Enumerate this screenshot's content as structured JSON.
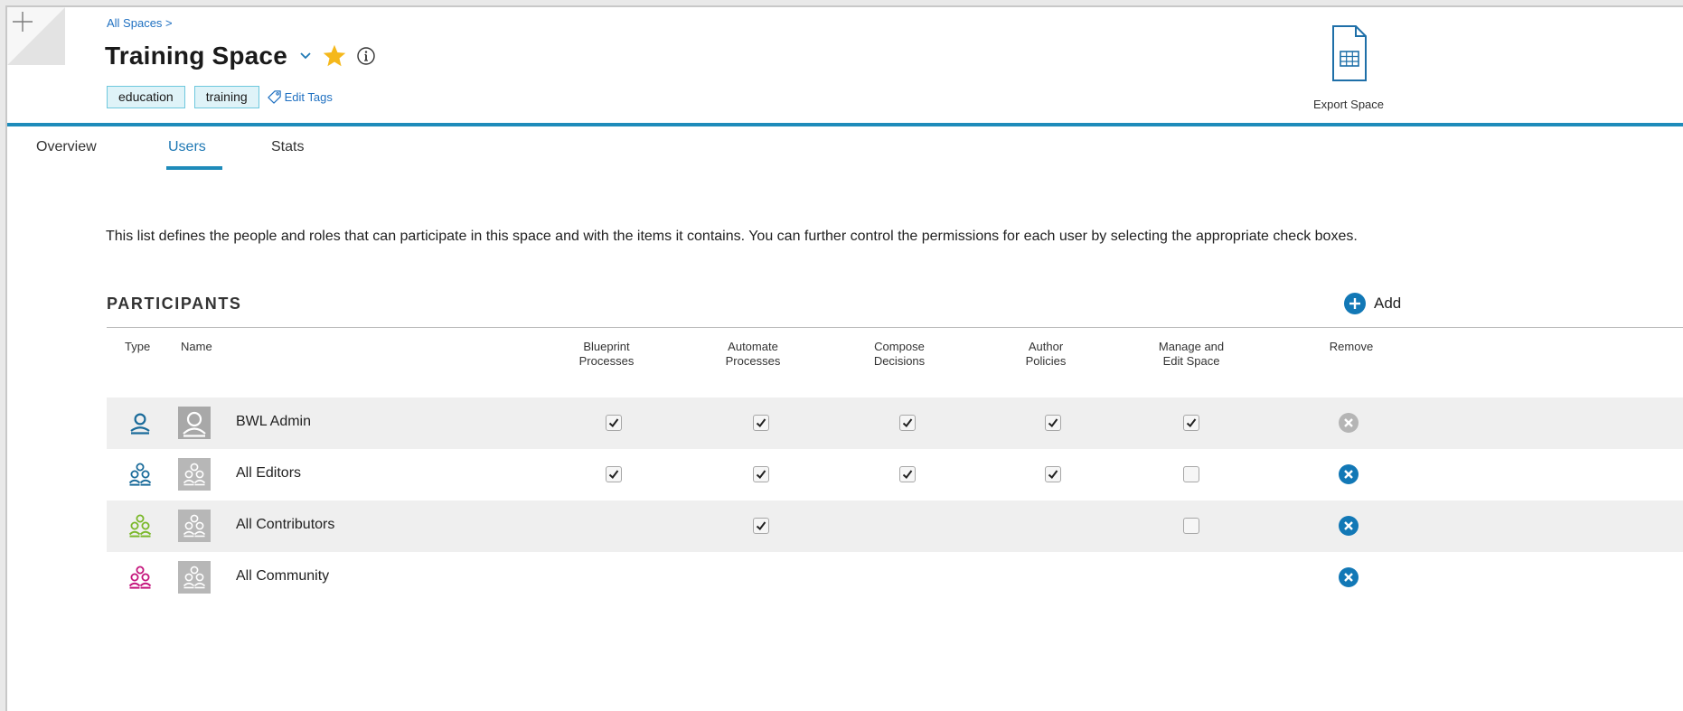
{
  "header": {
    "breadcrumb": "All Spaces >",
    "title": "Training Space",
    "tags": [
      "education",
      "training"
    ],
    "edit_tags_label": "Edit Tags",
    "export_label": "Export Space"
  },
  "tabs": [
    {
      "label": "Overview",
      "active": false
    },
    {
      "label": "Users",
      "active": true
    },
    {
      "label": "Stats",
      "active": false
    }
  ],
  "description": "This list defines the people and roles that can participate in this space and with the items it contains. You can further control the permissions for each user by selecting the appropriate check boxes.",
  "participants": {
    "title": "PARTICIPANTS",
    "add_label": "Add",
    "columns": {
      "type": "Type",
      "name": "Name",
      "blueprint": [
        "Blueprint",
        "Processes"
      ],
      "automate": [
        "Automate",
        "Processes"
      ],
      "compose": [
        "Compose",
        "Decisions"
      ],
      "author": [
        "Author",
        "Policies"
      ],
      "manage": [
        "Manage and",
        "Edit Space"
      ],
      "remove": "Remove"
    },
    "rows": [
      {
        "name": "BWL Admin",
        "type": "user",
        "color": "#1a6b9a",
        "perms": {
          "blueprint": true,
          "automate": true,
          "compose": true,
          "author": true,
          "manage": true
        },
        "remove_enabled": false
      },
      {
        "name": "All Editors",
        "type": "group",
        "color": "#1a6b9a",
        "perms": {
          "blueprint": true,
          "automate": true,
          "compose": true,
          "author": true,
          "manage": false
        },
        "remove_enabled": true
      },
      {
        "name": "All Contributors",
        "type": "group",
        "color": "#7ab829",
        "perms": {
          "blueprint": null,
          "automate": true,
          "compose": null,
          "author": null,
          "manage": false
        },
        "remove_enabled": true
      },
      {
        "name": "All Community",
        "type": "group",
        "color": "#c4147c",
        "perms": {
          "blueprint": null,
          "automate": null,
          "compose": null,
          "author": null,
          "manage": null
        },
        "remove_enabled": true
      }
    ]
  },
  "colors": {
    "accent": "#1e8bba",
    "link": "#1f70c1",
    "star": "#f5b81b",
    "remove": "#1278b6",
    "remove_disabled": "#b5b5b5"
  }
}
